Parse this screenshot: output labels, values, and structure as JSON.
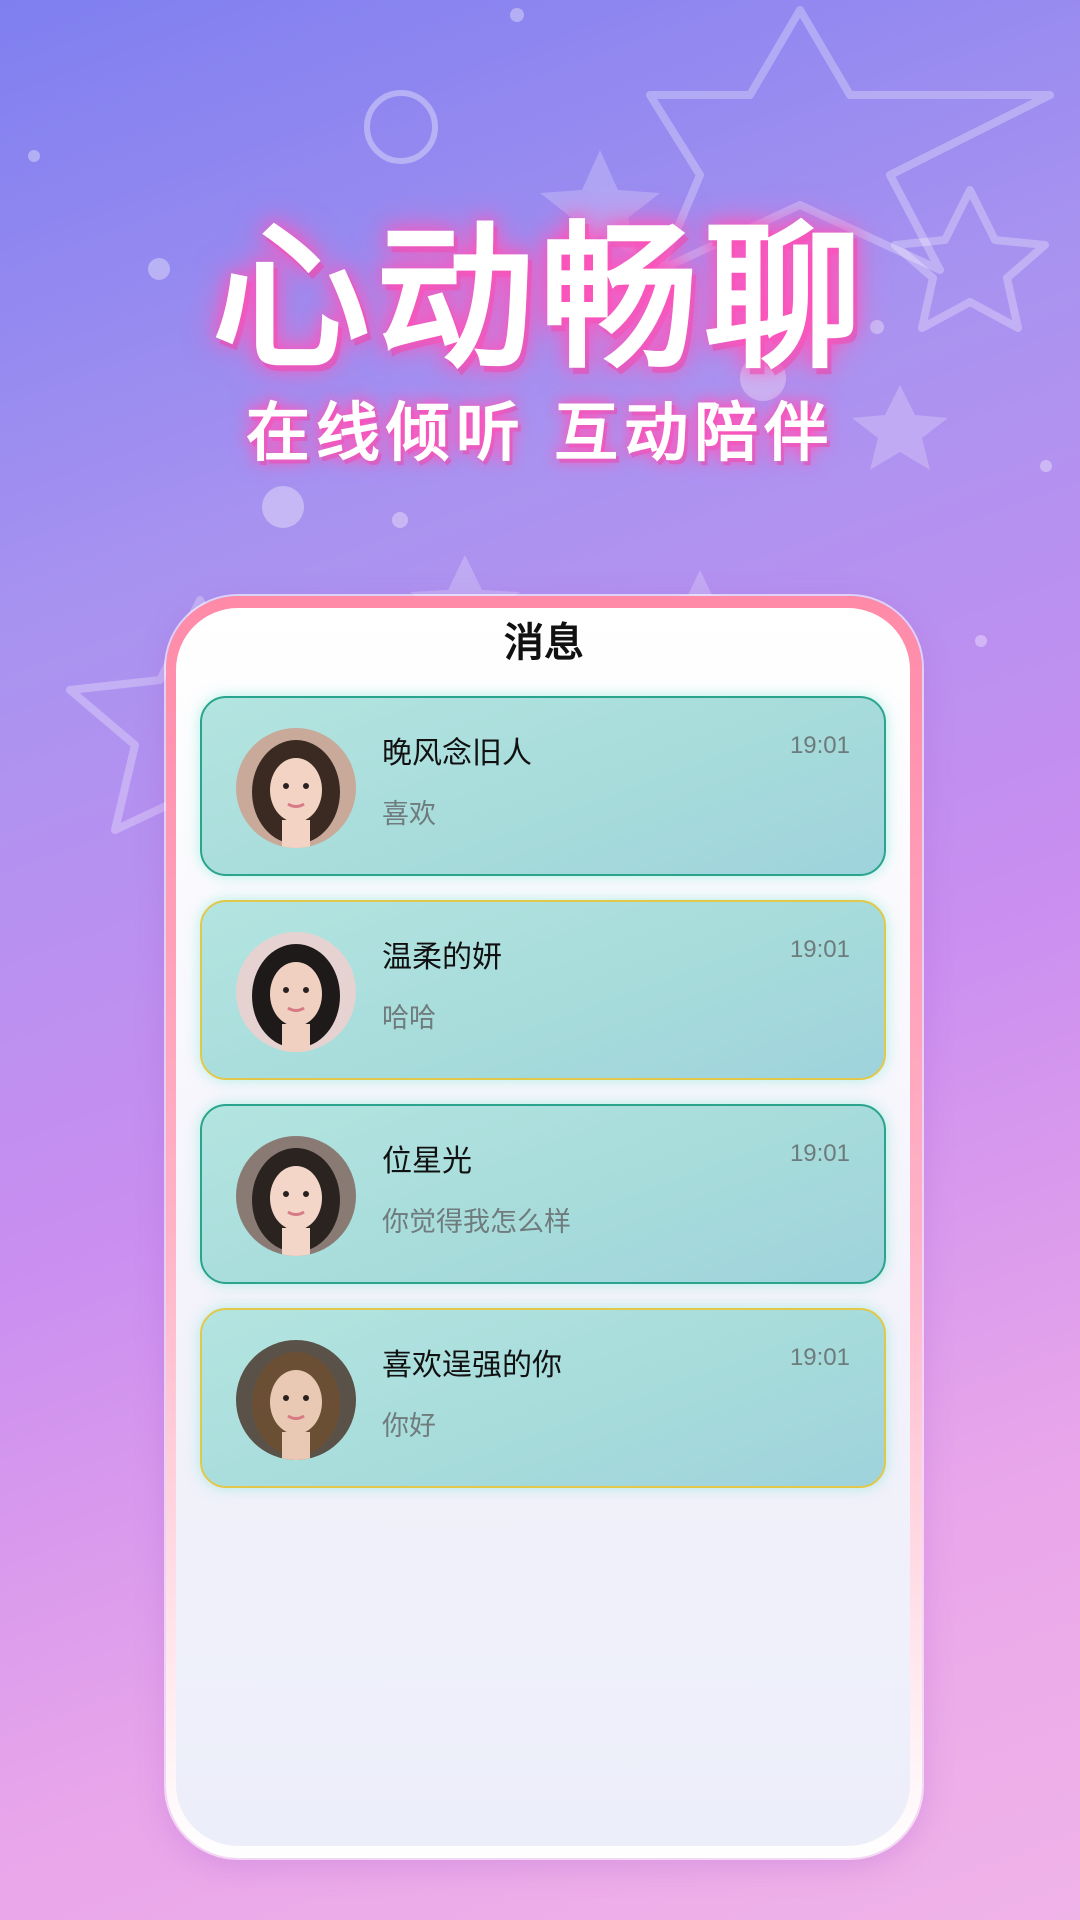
{
  "colors": {
    "accent_pink": "#ff4fb8",
    "card_bg": "#a7dcdb",
    "card_border_teal": "#2aa48c",
    "card_border_gold": "#e2c84a"
  },
  "hero": {
    "title": "心动畅聊",
    "subtitle": "在线倾听 互动陪伴"
  },
  "screen": {
    "title": "消息"
  },
  "messages": [
    {
      "name": "晚风念旧人",
      "preview": "喜欢",
      "time": "19:01",
      "border": "teal",
      "avatar": "avatar-photo"
    },
    {
      "name": "温柔的妍",
      "preview": "哈哈",
      "time": "19:01",
      "border": "gold",
      "avatar": "avatar-photo"
    },
    {
      "name": "位星光",
      "preview": "你觉得我怎么样",
      "time": "19:01",
      "border": "teal",
      "avatar": "avatar-photo"
    },
    {
      "name": "喜欢逞强的你",
      "preview": "你好",
      "time": "19:01",
      "border": "gold",
      "avatar": "avatar-photo"
    }
  ]
}
